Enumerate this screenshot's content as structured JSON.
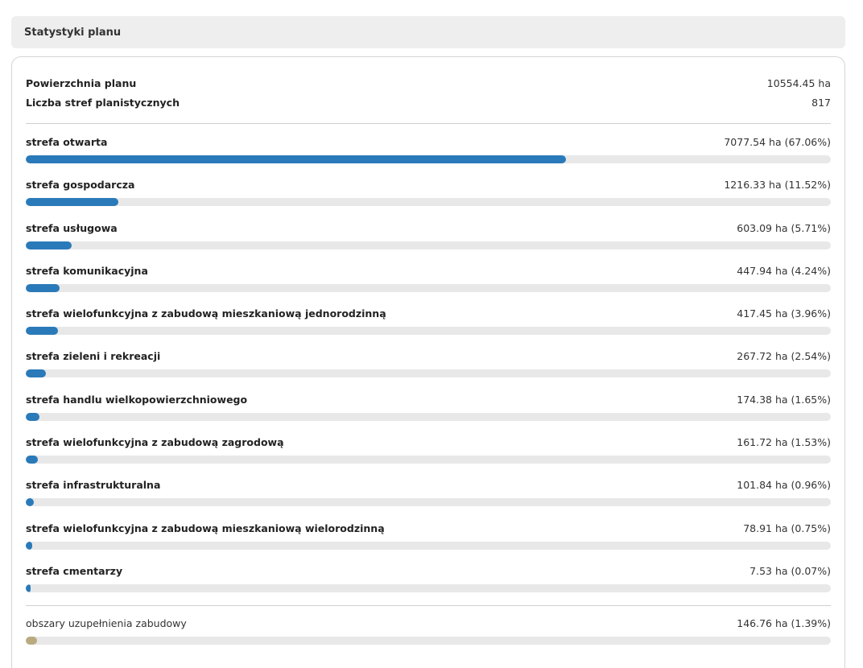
{
  "header": {
    "title": "Statystyki planu"
  },
  "summary": [
    {
      "label": "Powierzchnia planu",
      "value": "10554.45 ha"
    },
    {
      "label": "Liczba stref planistycznych",
      "value": "817"
    }
  ],
  "zones": [
    {
      "label": "strefa otwarta",
      "value": "7077.54 ha (67.06%)",
      "percent": 67.06
    },
    {
      "label": "strefa gospodarcza",
      "value": "1216.33 ha (11.52%)",
      "percent": 11.52
    },
    {
      "label": "strefa usługowa",
      "value": "603.09 ha (5.71%)",
      "percent": 5.71
    },
    {
      "label": "strefa komunikacyjna",
      "value": "447.94 ha (4.24%)",
      "percent": 4.24
    },
    {
      "label": "strefa wielofunkcyjna z zabudową mieszkaniową jednorodzinną",
      "value": "417.45 ha (3.96%)",
      "percent": 3.96
    },
    {
      "label": "strefa zieleni i rekreacji",
      "value": "267.72 ha (2.54%)",
      "percent": 2.54
    },
    {
      "label": "strefa handlu wielkopowierzchniowego",
      "value": "174.38 ha (1.65%)",
      "percent": 1.65
    },
    {
      "label": "strefa wielofunkcyjna z zabudową zagrodową",
      "value": "161.72 ha (1.53%)",
      "percent": 1.53
    },
    {
      "label": "strefa infrastrukturalna",
      "value": "101.84 ha (0.96%)",
      "percent": 0.96
    },
    {
      "label": "strefa wielofunkcyjna z zabudową mieszkaniową wielorodzinną",
      "value": "78.91 ha (0.75%)",
      "percent": 0.75
    },
    {
      "label": "strefa cmentarzy",
      "value": "7.53 ha (0.07%)",
      "percent": 0.07
    }
  ],
  "extra": {
    "label": "obszary uzupełnienia zabudowy",
    "value": "146.76 ha (1.39%)",
    "percent": 1.39
  },
  "colors": {
    "zone_bar": "#2a7ab9",
    "extra_bar": "#b9ab7f",
    "track": "#e8e8e8"
  }
}
